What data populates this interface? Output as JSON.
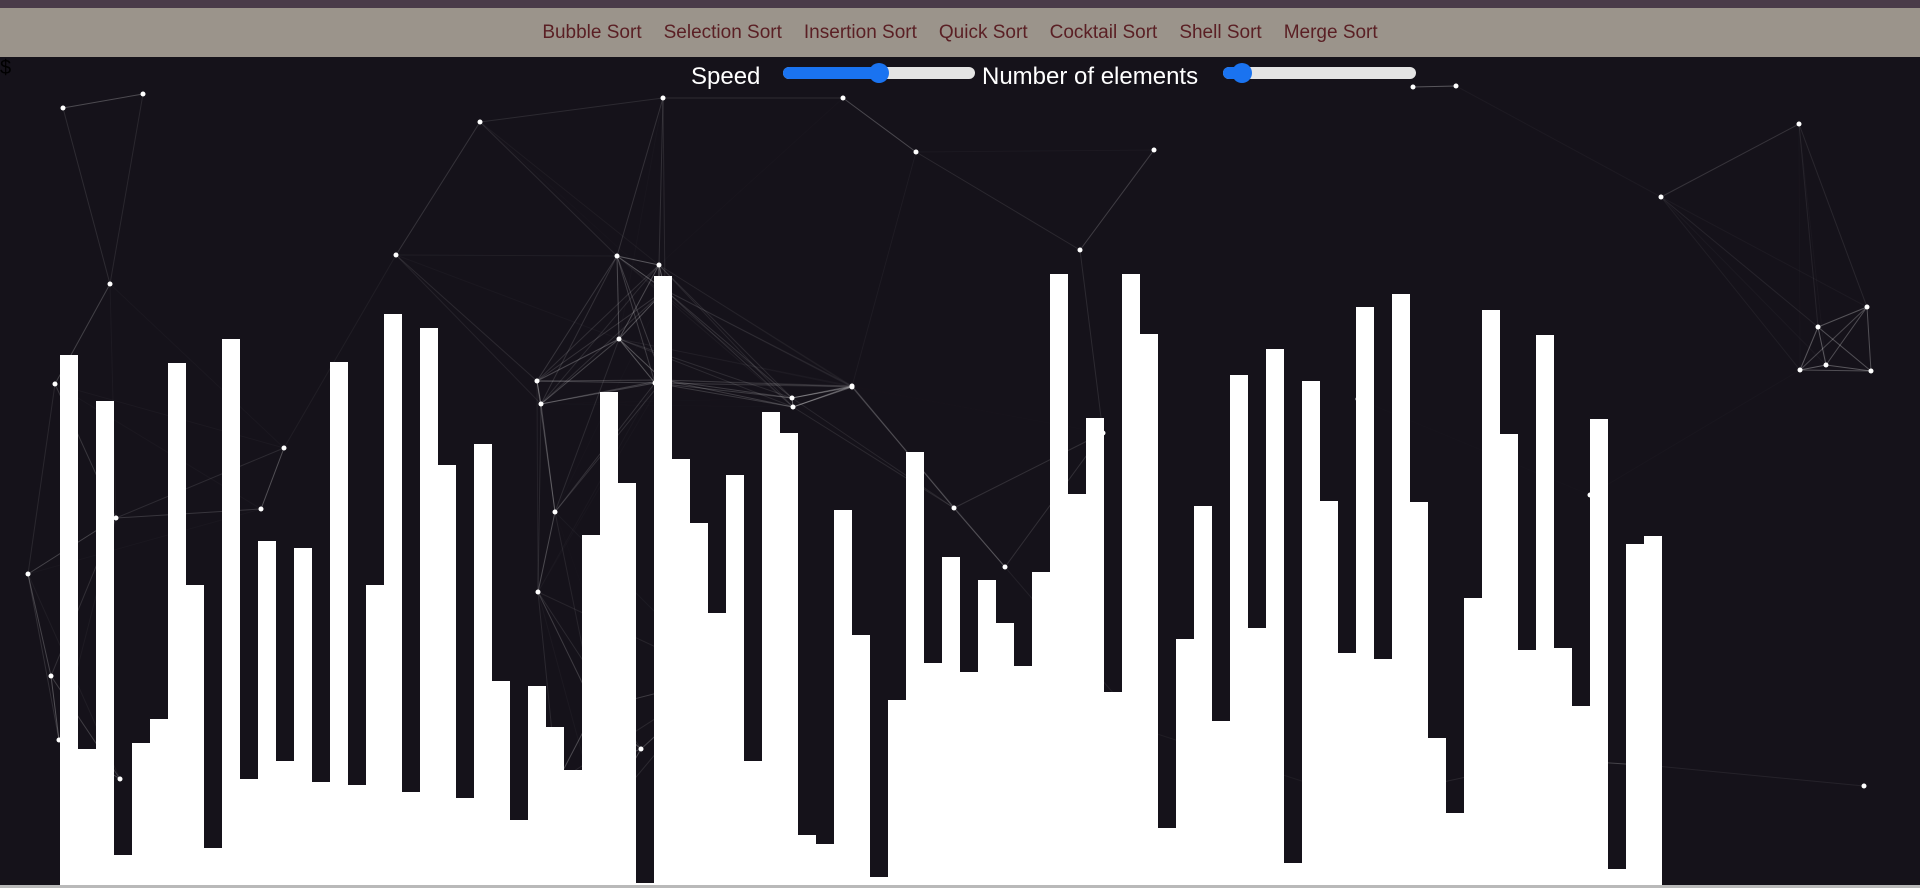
{
  "nav": {
    "items": [
      "Bubble Sort",
      "Selection Sort",
      "Insertion Sort",
      "Quick Sort",
      "Cocktail Sort",
      "Shell Sort",
      "Merge Sort"
    ]
  },
  "stray_text": "$",
  "controls": {
    "speed_label": "Speed",
    "speed_value": 0.5,
    "elements_label": "Number of elements",
    "elements_value": 0.1
  },
  "colors": {
    "background": "#15121a",
    "nav_background": "#9b948b",
    "nav_text": "#5a1f24",
    "slider_accent": "#1a73f0",
    "bars": "#ffffff"
  },
  "array_values": [
    530,
    136,
    484,
    30,
    142,
    166,
    522,
    300,
    37,
    546,
    106,
    344,
    124,
    337,
    103,
    523,
    100,
    300,
    571,
    93,
    557,
    420,
    87,
    441,
    204,
    65,
    199,
    158,
    115,
    350,
    493,
    402,
    2,
    609,
    426,
    362,
    272,
    410,
    124,
    473,
    452,
    50,
    41,
    375,
    250,
    8,
    185,
    433,
    222,
    328,
    213,
    305,
    262,
    219,
    313,
    611,
    391,
    467,
    193,
    611,
    551,
    57,
    246,
    379,
    164,
    510,
    257,
    536,
    22,
    504,
    384,
    232,
    578,
    226,
    591,
    383,
    147,
    72,
    287,
    575,
    451,
    235,
    550,
    237,
    179,
    466,
    16,
    341,
    349
  ]
}
